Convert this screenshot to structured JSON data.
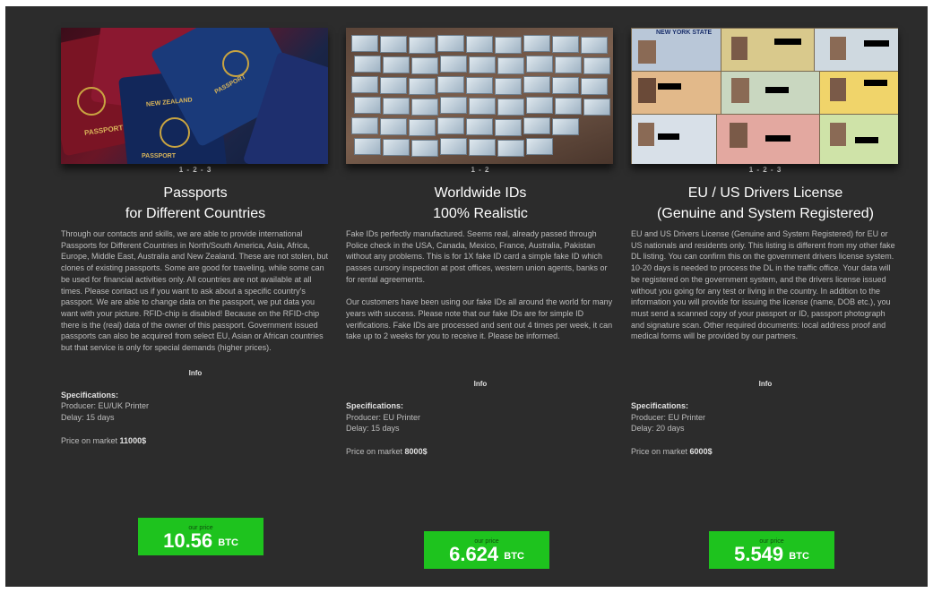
{
  "listings": [
    {
      "pager": "1 - 2 - 3",
      "image_desc": "passports-photo",
      "title_line1": "Passports",
      "title_line2": "for Different Countries",
      "description": [
        "Through our contacts and skills, we are able to provide international Passports for Different Countries in North/South America, Asia, Africa, Europe, Middle East, Australia and New Zealand. These are not stolen, but clones of existing passports. Some are good for traveling, while some can be used for financial activities only. All countries are not available at all times. Please contact us if you want to ask about a specific country's passport. We are able to change data on the passport, we put data you want with your picture. RFID-chip is disabled! Because on the RFID-chip there is the (real) data of the owner of this passport. Government issued passports can also be acquired from select EU, Asian or African countries but that service is only for special demands (higher prices)."
      ],
      "info_label": "Info",
      "specs_label": "Specifications:",
      "producer": "Producer: EU/UK Printer",
      "delay": "Delay: 15 days",
      "market_prefix": "Price on market",
      "market_price": "11000$",
      "our_price_label": "our price",
      "price": "10.56",
      "currency": "BTC"
    },
    {
      "pager": "1 - 2",
      "image_desc": "ids-photo",
      "title_line1": "Worldwide IDs",
      "title_line2": "100% Realistic",
      "description": [
        "Fake IDs perfectly manufactured. Seems real, already passed through Police check in the USA, Canada, Mexico, France, Australia, Pakistan without any problems. This is for 1X fake ID card a simple fake ID which passes cursory inspection at post offices, western union agents, banks or for rental agreements.",
        "Our customers have been using our fake IDs all around the world for many years with success. Please note that our fake IDs are for simple ID verifications. Fake IDs are processed and sent out 4 times per week, it can take up to 2 weeks for you to receive it. Please be informed."
      ],
      "info_label": "Info",
      "specs_label": "Specifications:",
      "producer": "Producer: EU Printer",
      "delay": "Delay: 15 days",
      "market_prefix": "Price on market",
      "market_price": "8000$",
      "our_price_label": "our price",
      "price": "6.624",
      "currency": "BTC"
    },
    {
      "pager": "1 - 2 - 3",
      "image_desc": "licenses-photo",
      "title_line1": "EU / US Drivers License",
      "title_line2": "(Genuine and System Registered)",
      "description": [
        "EU and US Drivers License (Genuine and System Registered) for EU or US nationals and residents only. This listing is different from my other fake DL listing. You can confirm this on the government drivers license system. 10-20 days is needed to process the DL in the traffic office. Your data will be registered on the government system, and the drivers license issued without you going for any test or living in the country. In addition to the information you will provide for issuing the license (name, DOB etc.), you must send a scanned copy of your passport or ID, passport photograph and signature scan. Other required documents: local address proof and medical forms will be provided by our partners."
      ],
      "info_label": "Info",
      "specs_label": "Specifications:",
      "producer": "Producer: EU Printer",
      "delay": "Delay: 20 days",
      "market_prefix": "Price on market",
      "market_price": "6000$",
      "our_price_label": "our price",
      "price": "5.549",
      "currency": "BTC"
    }
  ],
  "photo_text": {
    "passport_1": "PASSPORT",
    "passport_2": "NEW ZEALAND",
    "passport_3": "PASSPORT",
    "passport_4": "PASSPORT",
    "license_header": "NEW YORK STATE"
  },
  "colors": {
    "background": "#2c2c2c",
    "buy_button": "#1ec31e",
    "text": "#bdbdbd",
    "title": "#ffffff"
  }
}
